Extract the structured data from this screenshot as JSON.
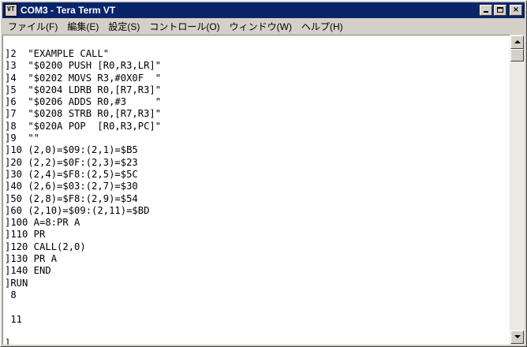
{
  "window": {
    "title": "COM3 - Tera Term VT",
    "icon_text": "VT",
    "close_glyph": "×"
  },
  "menu": [
    {
      "label": "ファイル(F)"
    },
    {
      "label": "編集(E)"
    },
    {
      "label": "設定(S)"
    },
    {
      "label": "コントロール(O)"
    },
    {
      "label": "ウィンドウ(W)"
    },
    {
      "label": "ヘルプ(H)"
    }
  ],
  "terminal": {
    "lines": [
      "]2  \"EXAMPLE CALL\"",
      "]3  \"$0200 PUSH [R0,R3,LR]\"",
      "]4  \"$0202 MOVS R3,#0X0F  \"",
      "]5  \"$0204 LDRB R0,[R7,R3]\"",
      "]6  \"$0206 ADDS R0,#3     \"",
      "]7  \"$0208 STRB R0,[R7,R3]\"",
      "]8  \"$020A POP  [R0,R3,PC]\"",
      "]9  \"\"",
      "]10 (2,0)=$09:(2,1)=$B5",
      "]20 (2,2)=$0F:(2,3)=$23",
      "]30 (2,4)=$F8:(2,5)=$5C",
      "]40 (2,6)=$03:(2,7)=$30",
      "]50 (2,8)=$F8:(2,9)=$54",
      "]60 (2,10)=$09:(2,11)=$BD",
      "]100 A=8:PR A",
      "]110 PR",
      "]120 CALL(2,0)",
      "]130 PR A",
      "]140 END",
      "]RUN",
      " 8",
      "",
      " 11",
      "",
      "]"
    ]
  },
  "colors": {
    "titlebar": "#0a246a",
    "terminal_bg": "#ffffff",
    "terminal_fg": "#000000",
    "chrome": "#d4d0c8"
  },
  "icons": {
    "app": "tera-term-icon",
    "minimize": "minimize-icon",
    "maximize": "maximize-icon",
    "close": "close-icon",
    "scroll_up": "arrow-up-icon",
    "scroll_down": "arrow-down-icon"
  }
}
